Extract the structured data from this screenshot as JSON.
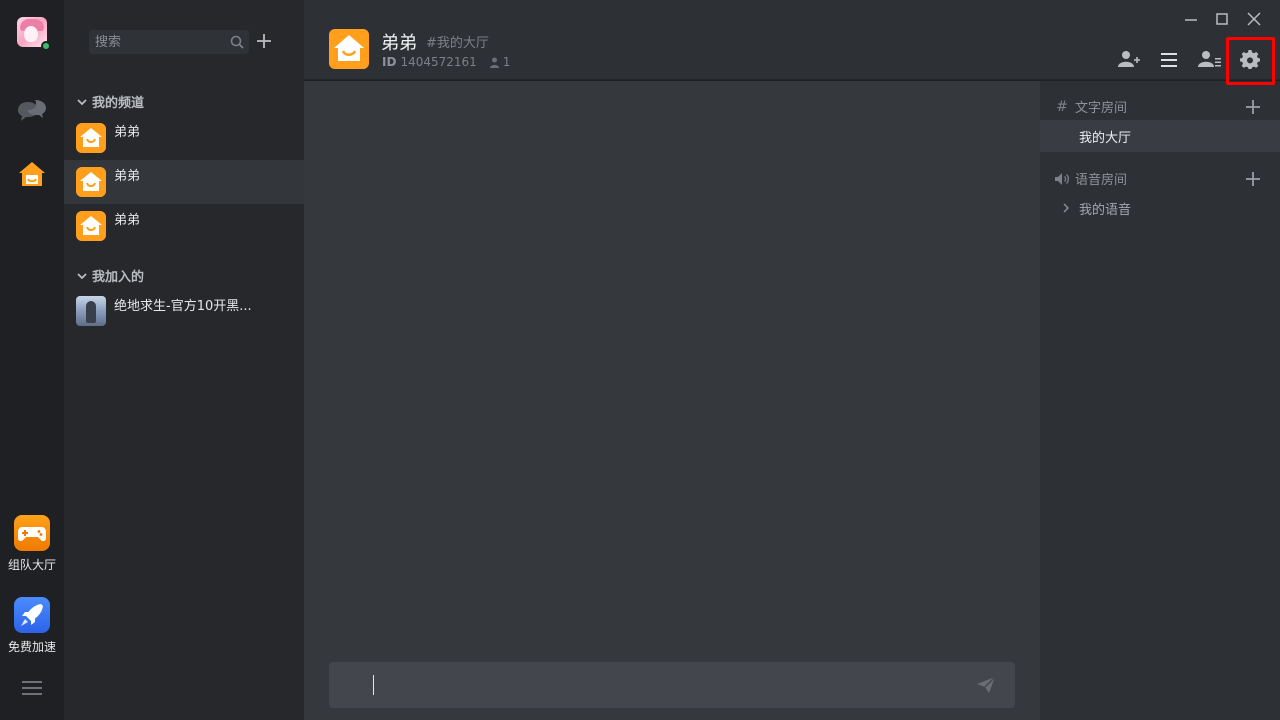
{
  "rail": {
    "team_label": "组队大厅",
    "boost_label": "免费加速"
  },
  "channel_list": {
    "search_placeholder": "搜索",
    "groups": {
      "mine": {
        "title": "我的频道",
        "channels": [
          {
            "name": "弟弟",
            "selected": false
          },
          {
            "name": "弟弟",
            "selected": true
          },
          {
            "name": "弟弟",
            "selected": false
          }
        ]
      },
      "joined": {
        "title": "我加入的",
        "channels": [
          {
            "name": "绝地求生-官方10开黑..."
          }
        ]
      }
    }
  },
  "header": {
    "title": "弟弟",
    "room": "#我的大厅",
    "id_label": "ID",
    "id_value": "1404572161",
    "member_count": "1"
  },
  "rooms": {
    "text_section": "文字房间",
    "text_items": [
      "我的大厅"
    ],
    "voice_section": "语音房间",
    "voice_items": [
      "我的语音"
    ]
  },
  "message": {
    "value": ""
  },
  "colors": {
    "accent_orange": "#ff9f1c",
    "highlight_red": "#ff0000",
    "online_green": "#3dbd6c",
    "boost_blue": "#3b78f6"
  },
  "icons": {
    "header_buttons": [
      "add-user-icon",
      "menu-icon",
      "members-icon",
      "gear-icon"
    ],
    "window_controls": [
      "minimize-icon",
      "maximize-icon",
      "close-icon"
    ]
  }
}
